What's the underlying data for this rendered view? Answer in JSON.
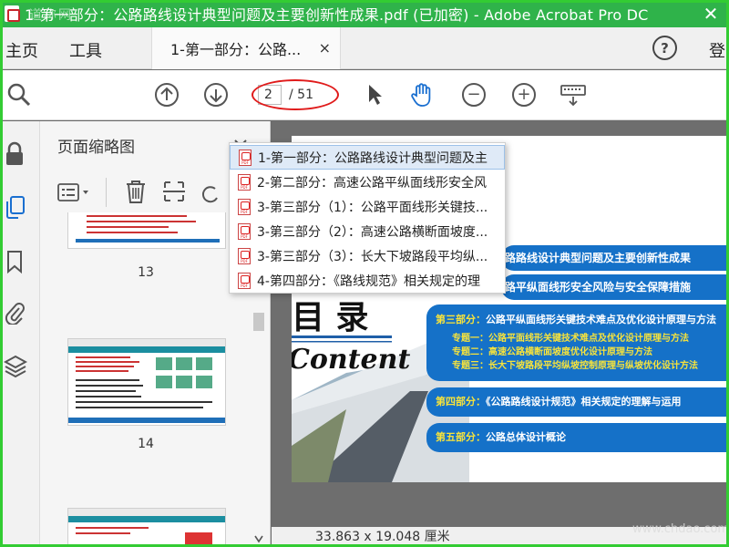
{
  "window": {
    "title": "1-第一部分：公路路线设计典型问题及主要创新性成果.pdf  (已加密)  - Adobe Acrobat Pro DC",
    "close_glyph": "✕"
  },
  "menu": {
    "home": "主页",
    "tools": "工具",
    "doc_tab": "1-第一部分：公路...",
    "tab_close": "×",
    "help": "?",
    "login": "登"
  },
  "toolbar": {
    "current_page": "2",
    "total_pages": "/ 51",
    "icons": [
      "zoom-search-icon",
      "page-up-icon",
      "page-down-icon",
      "select-arrow-icon",
      "hand-tool-icon",
      "zoom-out-icon",
      "zoom-in-icon",
      "keyboard-tool-icon"
    ]
  },
  "sidebar": {
    "panel_title": "页面缩略图",
    "rail_icons": [
      "lock-icon",
      "pages-icon",
      "bookmark-icon",
      "attachment-icon",
      "layers-icon"
    ],
    "thumbnails": [
      {
        "label": "13"
      },
      {
        "label": "14"
      }
    ]
  },
  "dropdown": {
    "items": [
      "1-第一部分：公路路线设计典型问题及主",
      "2-第二部分：高速公路平纵面线形安全风",
      "3-第三部分（1）：公路平面线形关键技...",
      "3-第三部分（2）：高速公路横断面坡度...",
      "3-第三部分（3）：长大下坡路段平均纵...",
      "4-第四部分：《路线规范》相关规定的理"
    ],
    "selected_index": 0
  },
  "document": {
    "heading": "目 录",
    "subheading": "Content",
    "pill1": "路路线设计典型问题及主要创新性成果",
    "pill2": "路平纵面线形安全风险与安全保障措施",
    "pill3_title": "第三部分：",
    "pill3_text": "公路平纵面线形关键技术难点及优化设计原理与方法",
    "topic1_label": "专题一：",
    "topic1": "公路平面线形关键技术难点及优化设计原理与方法",
    "topic2_label": "专题二：",
    "topic2": "高速公路横断面坡度优化设计原理与方法",
    "topic3_label": "专题三：",
    "topic3": "长大下坡路段平均纵坡控制原理与纵坡优化设计方法",
    "pill4_title": "第四部分：",
    "pill4_text": "《公路路线设计规范》相关规定的理解与运用",
    "pill5_title": "第五部分：",
    "pill5_text": "公路总体设计概论"
  },
  "status": {
    "page_size": "33.863 x 19.048 厘米"
  },
  "watermarks": {
    "top_left": "道称网",
    "bottom_right": "www.chdao.com"
  },
  "colors": {
    "title_bar": "#2fb34a",
    "page_oval": "#e01b1b",
    "pill_blue": "#1571c8",
    "highlight_yellow": "#f7e33c"
  }
}
